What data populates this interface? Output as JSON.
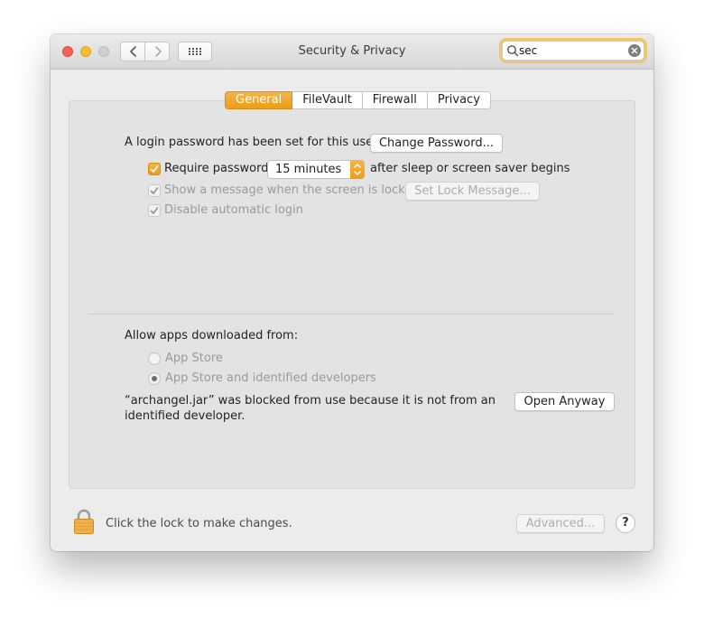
{
  "window": {
    "title": "Security & Privacy"
  },
  "search": {
    "value": "sec"
  },
  "tabs": [
    {
      "label": "General",
      "active": true
    },
    {
      "label": "FileVault",
      "active": false
    },
    {
      "label": "Firewall",
      "active": false
    },
    {
      "label": "Privacy",
      "active": false
    }
  ],
  "general": {
    "login_password_text": "A login password has been set for this user",
    "change_password_label": "Change Password...",
    "require_password": {
      "label": "Require password",
      "checked": true,
      "selected_option": "15 minutes",
      "suffix": "after sleep or screen saver begins"
    },
    "show_message": {
      "label": "Show a message when the screen is locked",
      "checked": true,
      "enabled": false,
      "button_label": "Set Lock Message..."
    },
    "disable_auto_login": {
      "label": "Disable automatic login",
      "checked": true,
      "enabled": false
    }
  },
  "gatekeeper": {
    "heading": "Allow apps downloaded from:",
    "options": [
      {
        "label": "App Store",
        "selected": false
      },
      {
        "label": "App Store and identified developers",
        "selected": true
      }
    ],
    "blocked_line1": "“archangel.jar” was blocked from use because it is not from an",
    "blocked_line2": "identified developer.",
    "open_anyway_label": "Open Anyway"
  },
  "footer": {
    "lock_text": "Click the lock to make changes.",
    "advanced_label": "Advanced...",
    "help_label": "?"
  },
  "colors": {
    "accent": "#ec9d17",
    "search_focus": "#f2c56d",
    "close": "#fe5f57",
    "minimize": "#febc2e"
  },
  "icons": {
    "back": "chevron-left-icon",
    "forward": "chevron-right-icon",
    "show_all": "grid-icon",
    "search": "search-icon",
    "clear": "clear-icon",
    "lock": "lock-icon"
  }
}
